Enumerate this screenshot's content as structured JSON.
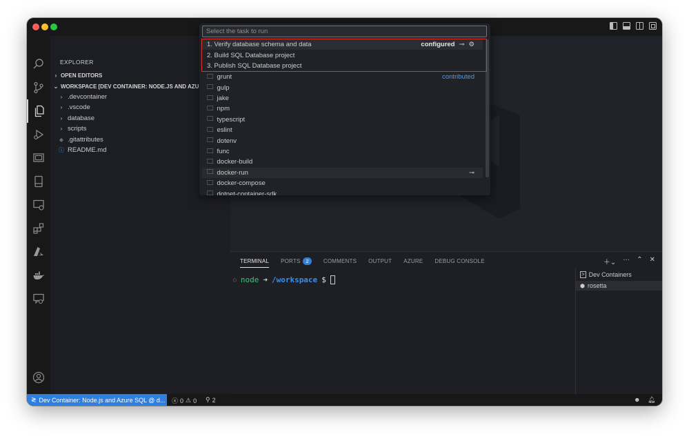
{
  "explorer": {
    "title": "EXPLORER",
    "open_editors": "OPEN EDITORS",
    "workspace": "WORKSPACE [DEV CONTAINER: NODE.JS AND AZUR",
    "items": [
      {
        "label": ".devcontainer",
        "type": "folder"
      },
      {
        "label": ".vscode",
        "type": "folder"
      },
      {
        "label": "database",
        "type": "folder"
      },
      {
        "label": "scripts",
        "type": "folder"
      },
      {
        "label": ".gitattributes",
        "type": "file"
      },
      {
        "label": "README.md",
        "type": "info-file"
      }
    ]
  },
  "quick_pick": {
    "placeholder": "Select the task to run",
    "tasks": [
      {
        "label": "1. Verify database schema and data",
        "detail": "configured"
      },
      {
        "label": "2. Build SQL Database project"
      },
      {
        "label": "3. Publish SQL Database project"
      }
    ],
    "providers": [
      {
        "label": "grunt",
        "detail": "contributed"
      },
      {
        "label": "gulp"
      },
      {
        "label": "jake"
      },
      {
        "label": "npm"
      },
      {
        "label": "typescript"
      },
      {
        "label": "eslint"
      },
      {
        "label": "dotenv"
      },
      {
        "label": "func"
      },
      {
        "label": "docker-build"
      },
      {
        "label": "docker-run"
      },
      {
        "label": "docker-compose"
      },
      {
        "label": "dotnet-container-sdk"
      }
    ]
  },
  "panel": {
    "tabs": [
      "TERMINAL",
      "PORTS",
      "COMMENTS",
      "OUTPUT",
      "AZURE",
      "DEBUG CONSOLE"
    ],
    "ports_badge": "2",
    "terminal": {
      "user": "node",
      "arrow": "➜",
      "path": "/workspace",
      "prompt": "$"
    },
    "terminal_list": [
      "Dev Containers",
      "rosetta"
    ]
  },
  "status": {
    "remote": "Dev Container: Node.js and Azure SQL @ d...",
    "errors": "0",
    "warnings": "0",
    "ports": "2"
  },
  "colors": {
    "accent": "#2f7fe0",
    "highlight_border": "#e0352b",
    "terminal_green": "#3fc37b",
    "terminal_path": "#3b8eea"
  }
}
